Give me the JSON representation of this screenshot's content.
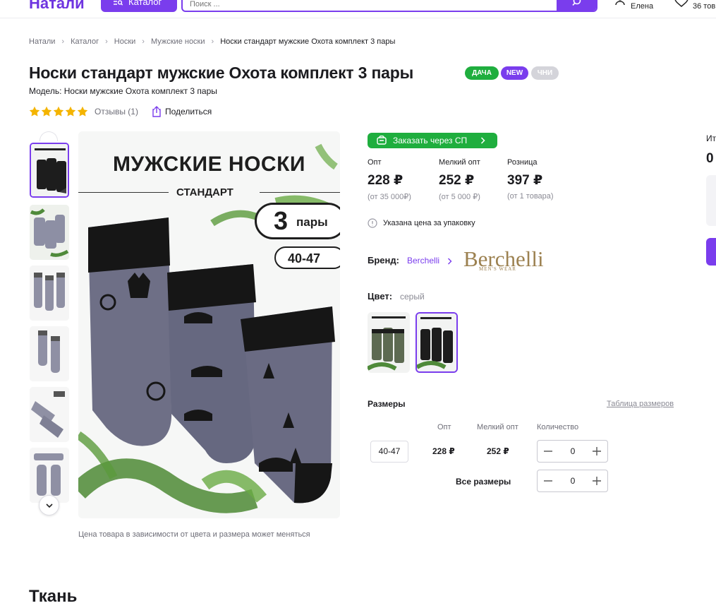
{
  "header": {
    "logo": "Натали",
    "catalog_label": "Каталог",
    "search_placeholder": "Поиск ...",
    "user_label": "Елена",
    "favorites_label": "36 тов"
  },
  "breadcrumbs": [
    "Натали",
    "Каталог",
    "Носки",
    "Мужские носки",
    "Носки стандарт мужские Охота комплект 3 пары"
  ],
  "product": {
    "title": "Носки стандарт мужские Охота комплект 3 пары",
    "badges": [
      "ДАЧА",
      "NEW",
      "ЧНИ"
    ],
    "model": "Модель: Носки мужские Охота комплект 3 пары",
    "rating": 5,
    "reviews_label": "Отзывы (1)",
    "share_label": "Поделиться",
    "image_caption": "Цена товара в зависимости от цвета и размера может меняться",
    "image": {
      "title": "МУЖСКИЕ НОСКИ",
      "subtitle": "СТАНДАРТ",
      "pairs_number": "3",
      "pairs_word": "пары",
      "size": "40-47"
    },
    "thumbnails_count": 6
  },
  "purchase": {
    "sp_button": "Заказать через СП",
    "prices": [
      {
        "label": "Опт",
        "value": "228 ₽",
        "note": "(от 35 000₽)"
      },
      {
        "label": "Мелкий опт",
        "value": "252 ₽",
        "note": "(от 5 000 ₽)"
      },
      {
        "label": "Розница",
        "value": "397 ₽",
        "note": "(от 1 товара)"
      }
    ],
    "price_info": "Указана цена за упаковку",
    "brand_label": "Бренд:",
    "brand_name": "Berchelli",
    "brand_logo_name": "Berchelli",
    "brand_logo_tag": "MEN'S WEAR",
    "color_label": "Цвет:",
    "color_value": "серый",
    "sizes_label": "Размеры",
    "sizes_table_link": "Таблица размеров",
    "columns": [
      "Опт",
      "Мелкий опт",
      "Количество"
    ],
    "rows": [
      {
        "size": "40-47",
        "opt": "228 ₽",
        "small_opt": "252 ₽",
        "qty": "0"
      }
    ],
    "all_sizes_label": "Все размеры",
    "all_sizes_qty": "0"
  },
  "sidebar": {
    "total_label": "Ит",
    "total_value": "0"
  },
  "section_fabric": "Ткань",
  "colors": {
    "accent": "#7a3ded",
    "green": "#1fae3e",
    "sock_gray": "#6e6f86",
    "sock_black": "#161616"
  }
}
